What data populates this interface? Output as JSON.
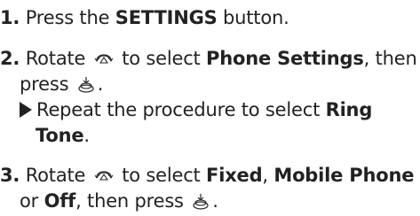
{
  "steps": [
    {
      "number": "1.",
      "text_a": "Press the ",
      "bold_a": "SETTINGS",
      "text_b": " button."
    },
    {
      "number": "2.",
      "text_a": "Rotate",
      "icon_a": "rotate-dial-icon",
      "text_b": "to select ",
      "bold_a": "Phone Settings",
      "text_c": ", then",
      "text_d": "press",
      "icon_b": "press-dial-icon",
      "text_e": ".",
      "note": {
        "icon": "arrow-right-icon",
        "text_a": "Repeat the procedure to select ",
        "bold_a": "Ring",
        "bold_b": "Tone",
        "text_b": "."
      }
    },
    {
      "number": "3.",
      "text_a": "Rotate",
      "icon_a": "rotate-dial-icon",
      "text_b": "to select ",
      "bold_a": "Fixed",
      "text_c": ", ",
      "bold_b": "Mobile Phone",
      "text_d": "or ",
      "bold_c": "Off",
      "text_e": ", then press",
      "icon_b": "press-dial-icon",
      "text_f": "."
    }
  ],
  "colors": {
    "text": "#222222",
    "background": "#ffffff"
  }
}
